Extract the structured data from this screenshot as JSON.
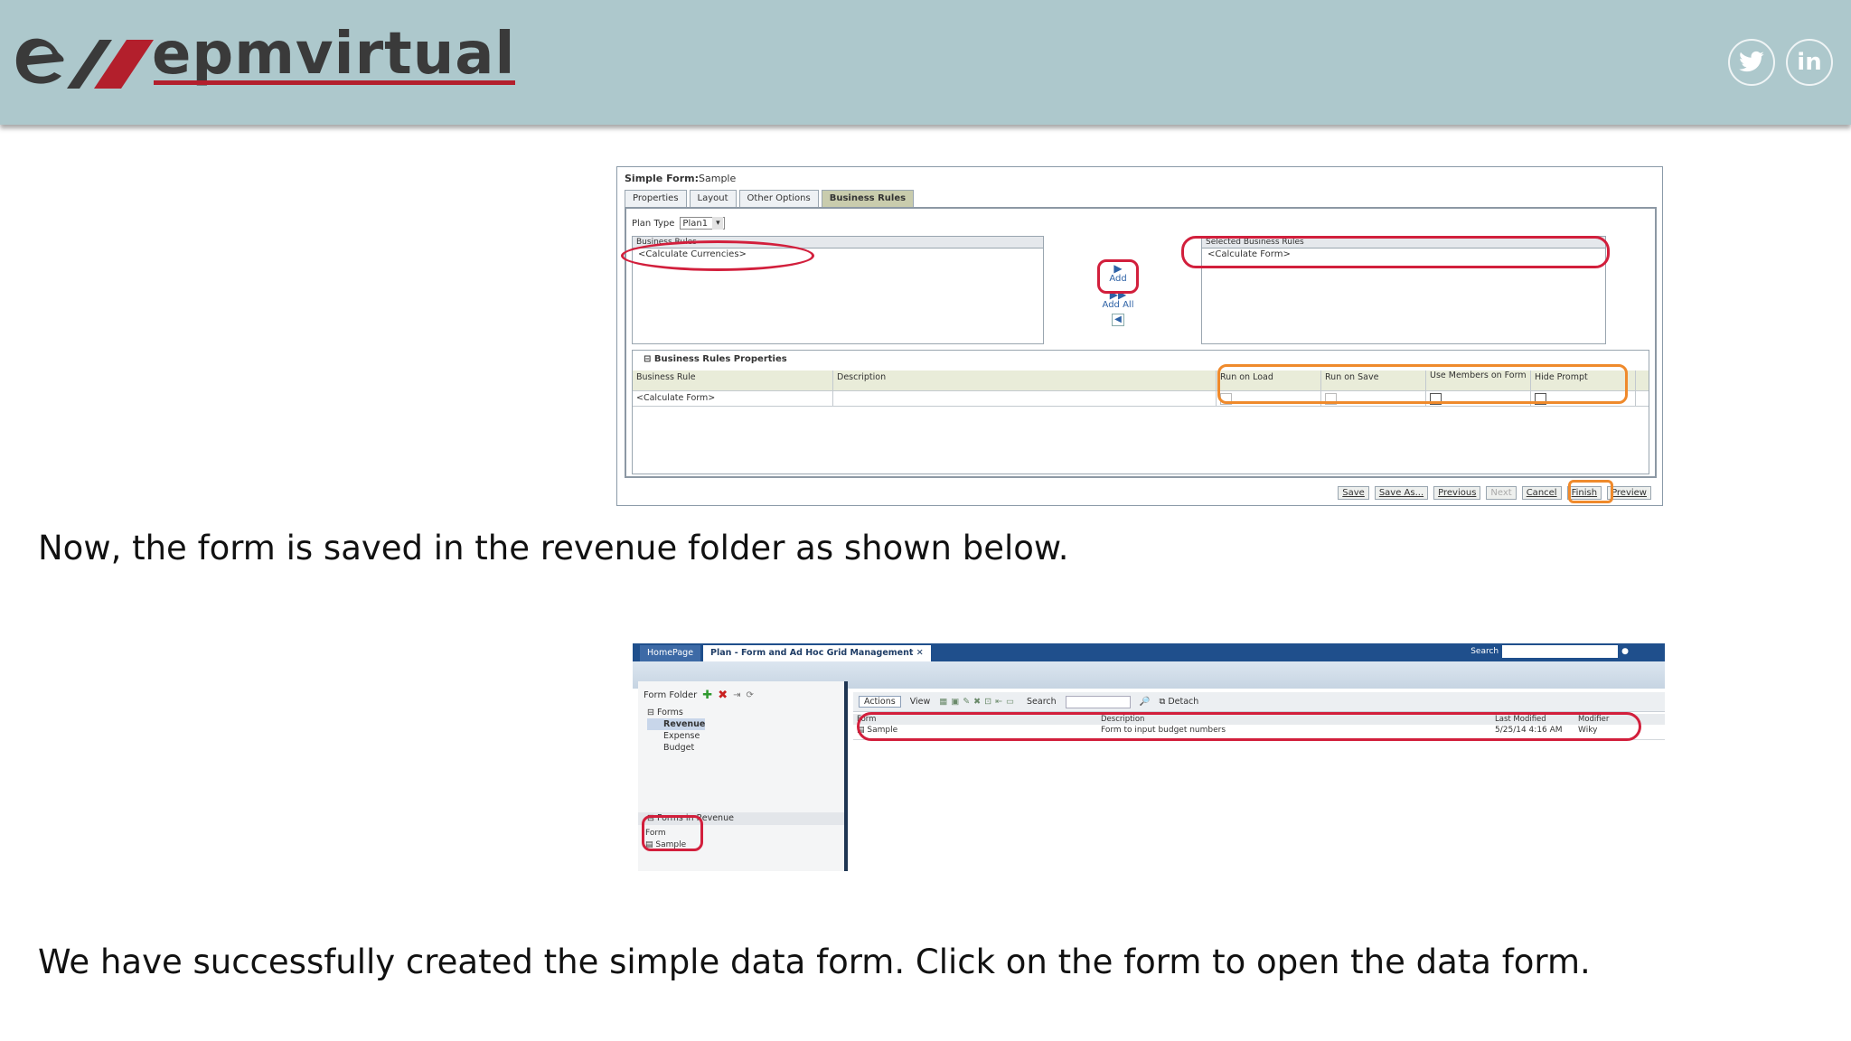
{
  "header": {
    "brand": "epmvirtual",
    "social": [
      {
        "name": "twitter-icon",
        "glyph": "🐦"
      },
      {
        "name": "linkedin-icon",
        "glyph": "in"
      }
    ],
    "colors": {
      "bar": "#adc8cc",
      "brand_red": "#b31f2c",
      "brand_dark": "#3a3a3a"
    }
  },
  "captions": {
    "first": "Now, the form is saved in the revenue folder as shown below.",
    "second": "We have successfully created the simple data form. Click on the form to open the data form."
  },
  "shot1": {
    "title_label": "Simple Form:",
    "title_value": "Sample",
    "tabs": [
      "Properties",
      "Layout",
      "Other Options",
      "Business Rules"
    ],
    "plan_type_label": "Plan Type",
    "plan_type_value": "Plan1",
    "business_rules_header": "Business Rules",
    "business_rules_item": "<Calculate Currencies>",
    "selected_rules_header": "Selected Business Rules",
    "selected_rules_item": "<Calculate Form>",
    "add_label": "Add",
    "add_all_label": "Add All",
    "properties_title": "Business Rules Properties",
    "grid_headers": [
      "Business Rule",
      "Description",
      "Run on Load",
      "Run on Save",
      "Use Members on Form",
      "Hide Prompt"
    ],
    "grid_row": [
      "<Calculate Form>",
      ""
    ],
    "buttons": [
      "Save",
      "Save As...",
      "Previous",
      "Next",
      "Cancel",
      "Finish",
      "Preview"
    ]
  },
  "shot2": {
    "tab_home": "HomePage",
    "tab_plan": "Plan - Form and Ad Hoc Grid Management",
    "search_label": "Search",
    "form_folder_label": "Form Folder",
    "tree": [
      "Forms",
      "Revenue",
      "Expense",
      "Budget"
    ],
    "forms_in_label": "Forms in Revenue",
    "form_col": "Form",
    "form_item": "Sample",
    "toolbar": {
      "actions": "Actions",
      "view": "View",
      "search": "Search",
      "detach": "Detach"
    },
    "grid_headers": [
      "Form",
      "Description",
      "Last Modified",
      "Modifier"
    ],
    "grid_row": [
      "Sample",
      "Form to input budget numbers",
      "5/25/14 4:16 AM",
      "Wiky"
    ]
  }
}
